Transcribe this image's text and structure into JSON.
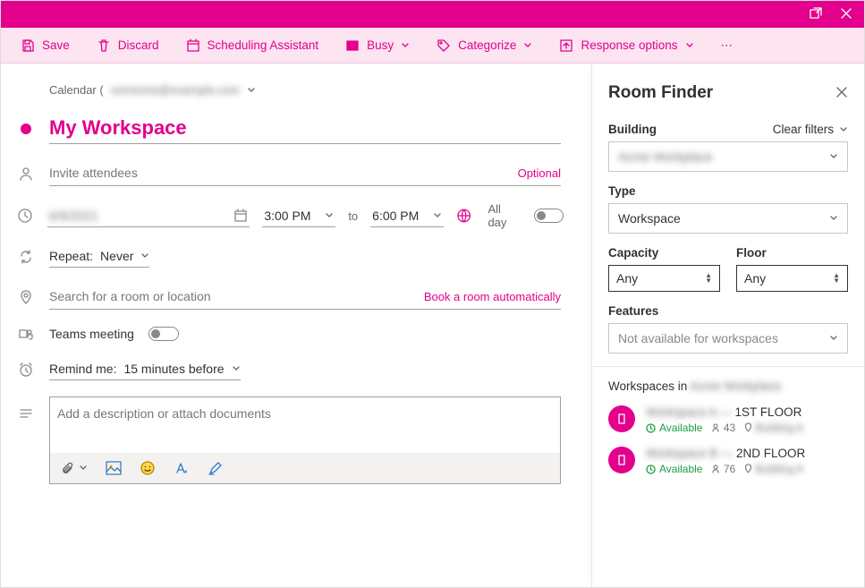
{
  "toolbar": {
    "save": "Save",
    "discard": "Discard",
    "scheduling": "Scheduling Assistant",
    "busy": "Busy",
    "categorize": "Categorize",
    "response": "Response options"
  },
  "crumb": {
    "prefix": "Calendar (",
    "account": "someone@example.com"
  },
  "event": {
    "subject": "My Workspace",
    "attendees_ph": "Invite attendees",
    "optional": "Optional",
    "date": "6/9/2021",
    "start": "3:00 PM",
    "to": "to",
    "end": "6:00 PM",
    "allday": "All day",
    "repeat_label": "Repeat:",
    "repeat_value": "Never",
    "location_ph": "Search for a room or location",
    "book_auto": "Book a room automatically",
    "teams": "Teams meeting",
    "remind_label": "Remind me:",
    "remind_value": "15 minutes before",
    "desc_ph": "Add a description or attach documents"
  },
  "rf": {
    "title": "Room Finder",
    "building_label": "Building",
    "clear": "Clear filters",
    "building_value": "Acme Workplace",
    "type_label": "Type",
    "type_value": "Workspace",
    "capacity_label": "Capacity",
    "capacity_value": "Any",
    "floor_label": "Floor",
    "floor_value": "Any",
    "features_label": "Features",
    "features_value": "Not available for workspaces",
    "list_label_prefix": "Workspaces in ",
    "list_label_building": "Acme Workplace",
    "items": [
      {
        "name_blur": "Workspace A — ",
        "name_clear": "1ST FLOOR",
        "status": "Available",
        "cap": "43",
        "loc": "Building A"
      },
      {
        "name_blur": "Workspace B — ",
        "name_clear": "2ND FLOOR",
        "status": "Available",
        "cap": "76",
        "loc": "Building A"
      }
    ]
  }
}
